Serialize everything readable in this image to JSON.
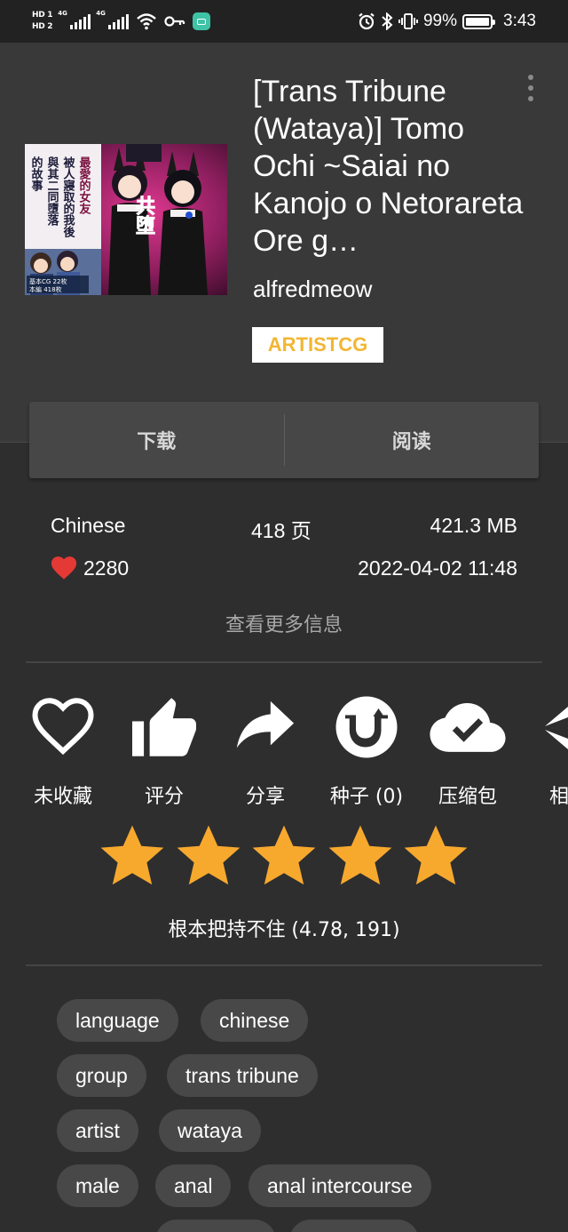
{
  "status_bar": {
    "hd1": "HD 1",
    "hd2": "HD 2",
    "net1": "4G",
    "net2": "4G",
    "battery_level": 0.99,
    "battery": "99%",
    "time": "3:43"
  },
  "gallery": {
    "title": "[Trans Tribune (Wataya)] Tomo Ochi ~Saiai no Kanojo o Netorareta Ore g…",
    "uploader": "alfredmeow",
    "category": "ARTISTCG",
    "category_color": "#f2b632",
    "cover": {
      "title_chars": "共堕",
      "vertical_text": [
        "最愛的女友",
        "被人寢取的我後",
        "與其二同墮落",
        "的故事"
      ],
      "badge_line1": "基本CG 22枚",
      "badge_line2": "本編 418枚"
    }
  },
  "actions": {
    "download": "下载",
    "read": "阅读"
  },
  "info": {
    "language": "Chinese",
    "pages": "418 页",
    "size": "421.3 MB",
    "favorites": "2280",
    "posted": "2022-04-02 11:48",
    "more": "查看更多信息"
  },
  "tool_items": [
    {
      "icon": "heart-outline-icon",
      "label": "未收藏"
    },
    {
      "icon": "thumbs-up-icon",
      "label": "评分"
    },
    {
      "icon": "share-icon",
      "label": "分享"
    },
    {
      "icon": "torrent-icon",
      "label": "种子 (0)"
    },
    {
      "icon": "cloud-download-icon",
      "label": "压缩包"
    },
    {
      "icon": "similar-icon",
      "label": "相似"
    }
  ],
  "rating": {
    "stars": 5,
    "text": "根本把持不住 (4.78, 191)",
    "star_color": "#f7a92e"
  },
  "tags": [
    [
      "language",
      "chinese"
    ],
    [
      "group",
      "trans tribune"
    ],
    [
      "artist",
      "wataya"
    ],
    [
      "male",
      "anal",
      "anal intercourse"
    ]
  ],
  "colors": {
    "background": "#2e2e2e",
    "header": "#393939",
    "heart": "#e53935",
    "tag_bg": "#484848"
  }
}
